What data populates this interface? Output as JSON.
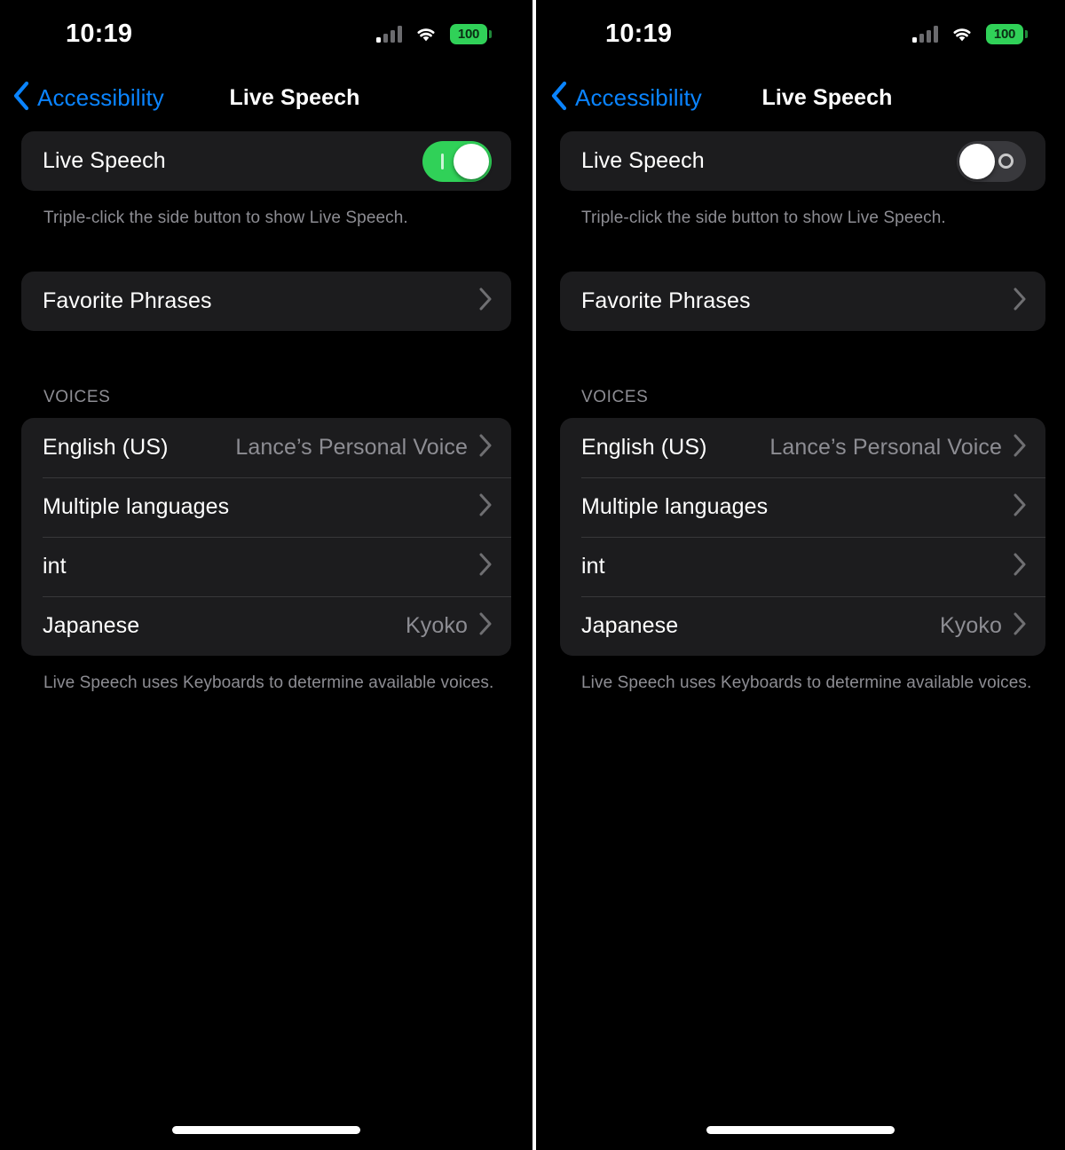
{
  "panels": [
    {
      "id": "left",
      "status": {
        "time": "10:19",
        "battery": "100",
        "signal_bars": 4,
        "signal_active": 1,
        "wifi": "wifi-icon"
      },
      "nav": {
        "back_label": "Accessibility",
        "title": "Live Speech"
      },
      "toggle_row": {
        "label": "Live Speech",
        "state": "on",
        "indicator": "line"
      },
      "toggle_footnote": "Triple-click the side button to show Live Speech.",
      "favorites": {
        "label": "Favorite Phrases"
      },
      "voices_header": "VOICES",
      "voices": [
        {
          "label": "English (US)",
          "value": "Lance’s Personal Voice"
        },
        {
          "label": "Multiple languages",
          "value": ""
        },
        {
          "label": "int",
          "value": ""
        },
        {
          "label": "Japanese",
          "value": "Kyoko"
        }
      ],
      "voices_footnote": "Live Speech uses Keyboards to determine available voices."
    },
    {
      "id": "right",
      "status": {
        "time": "10:19",
        "battery": "100",
        "signal_bars": 4,
        "signal_active": 1,
        "wifi": "wifi-icon"
      },
      "nav": {
        "back_label": "Accessibility",
        "title": "Live Speech"
      },
      "toggle_row": {
        "label": "Live Speech",
        "state": "off",
        "indicator": "circle"
      },
      "toggle_footnote": "Triple-click the side button to show Live Speech.",
      "favorites": {
        "label": "Favorite Phrases"
      },
      "voices_header": "VOICES",
      "voices": [
        {
          "label": "English (US)",
          "value": "Lance’s Personal Voice"
        },
        {
          "label": "Multiple languages",
          "value": ""
        },
        {
          "label": "int",
          "value": ""
        },
        {
          "label": "Japanese",
          "value": "Kyoko"
        }
      ],
      "voices_footnote": "Live Speech uses Keyboards to determine available voices."
    }
  ],
  "colors": {
    "accent_blue": "#0a84ff",
    "toggle_on_green": "#30d158",
    "toggle_off_gray": "#39393d",
    "card_bg": "#1c1c1e",
    "page_bg": "#000000",
    "secondary_text": "#8d8d93",
    "separator": "#38383a"
  }
}
